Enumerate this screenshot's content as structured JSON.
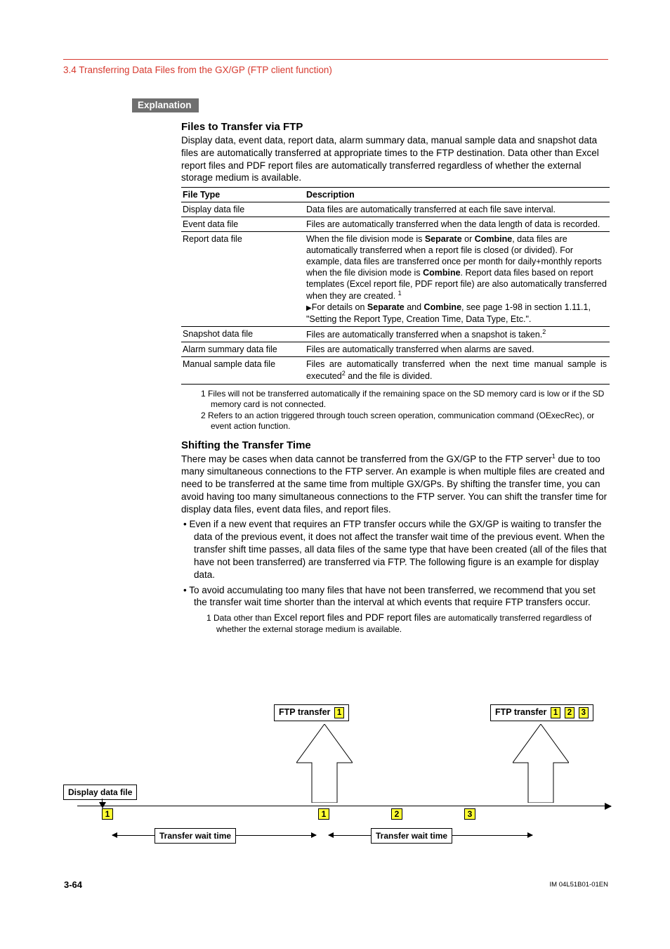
{
  "breadcrumb": "3.4  Transferring Data Files from the GX/GP (FTP client function)",
  "explanation_label": "Explanation",
  "files_heading": "Files to Transfer via FTP",
  "files_para": "Display data, event data, report data, alarm summary data, manual sample data and snapshot data files are automatically transferred at appropriate times to the FTP destination. Data other than Excel report files and PDF report files are automatically transferred regardless of whether the external storage medium is available.",
  "table_header": {
    "c1": "File Type",
    "c2": "Description"
  },
  "table_rows": [
    {
      "c1": "Display data file",
      "c2": "Data files are automatically transferred at each file save interval."
    },
    {
      "c1": "Event data file",
      "c2": "Files are automatically transferred when the data length of data is recorded."
    },
    {
      "c1": "Report data file",
      "c2_pre": "When the file division mode is ",
      "sep": "Separate",
      "c2_mid1": " or ",
      "comb": "Combine",
      "c2_mid2": ", data files are automatically transferred when a report file is closed (or divided). For example, data files are transferred once per month for daily+monthly reports when the file division mode is ",
      "comb2": "Combine",
      "c2_mid3": ". Report data files based on report templates (Excel report file, PDF report file) are also automatically transferred when they are created. ",
      "sup1": "1",
      "tri": "▶",
      "c2_det_pre": "For details on ",
      "c2_det_mid": " and ",
      "c2_det_post": ", see page 1-98 in section 1.11.1, \"Setting the Report Type, Creation Time, Data Type, Etc.\"."
    },
    {
      "c1": "Snapshot data file",
      "c2": "Files are automatically transferred when a snapshot is taken.",
      "sup": "2"
    },
    {
      "c1": "Alarm summary data file",
      "c2": "Files are automatically transferred when alarms are saved."
    },
    {
      "c1": "Manual sample data file",
      "c2a": "Files are automatically transferred when the next time manual sample is executed",
      "sup": "2",
      "c2b": " and the file is divided."
    }
  ],
  "foot1": "1  Files will not be transferred automatically if the remaining space on the SD memory card is low or if the SD memory card is not connected.",
  "foot2": "2  Refers to an action triggered through touch screen operation, communication command (OExecRec), or event action function.",
  "shift_heading": "Shifting the Transfer Time",
  "shift_para_pre": "There may be cases when data cannot be transferred from the GX/GP to the FTP server",
  "shift_sup": "1",
  "shift_para_post": " due to too many simultaneous connections to the FTP server. An example is when multiple files are created and need to be transferred at the same time from multiple GX/GPs. By shifting the transfer time, you can avoid having too many simultaneous connections to the FTP server. You can shift the transfer time for display data files, event data files, and report files.",
  "bullet1": "Even if a new event that requires an FTP transfer occurs while the GX/GP is waiting to transfer the data of the previous event, it does not affect the transfer wait time of the previous event. When the transfer shift time passes, all data files of the same type that have been created (all of the files that have not been transferred) are transferred via FTP. The following figure is an example for display data.",
  "bullet2": "To avoid accumulating too many files that have not been transferred, we recommend that you set the transfer wait time shorter than the interval at which events that require FTP transfers occur.",
  "subfoot_pre": "1  Data other than ",
  "subfoot_mid": "Excel report files and PDF report files ",
  "subfoot_post": "are automatically transferred regardless of whether the external storage medium is available.",
  "diagram": {
    "display_file": "Display data file",
    "ftp_transfer": "FTP transfer",
    "wait_time": "Transfer wait time",
    "tags": {
      "one": "1",
      "two": "2",
      "three": "3"
    }
  },
  "footer_page": "3-64",
  "footer_im": "IM 04L51B01-01EN"
}
